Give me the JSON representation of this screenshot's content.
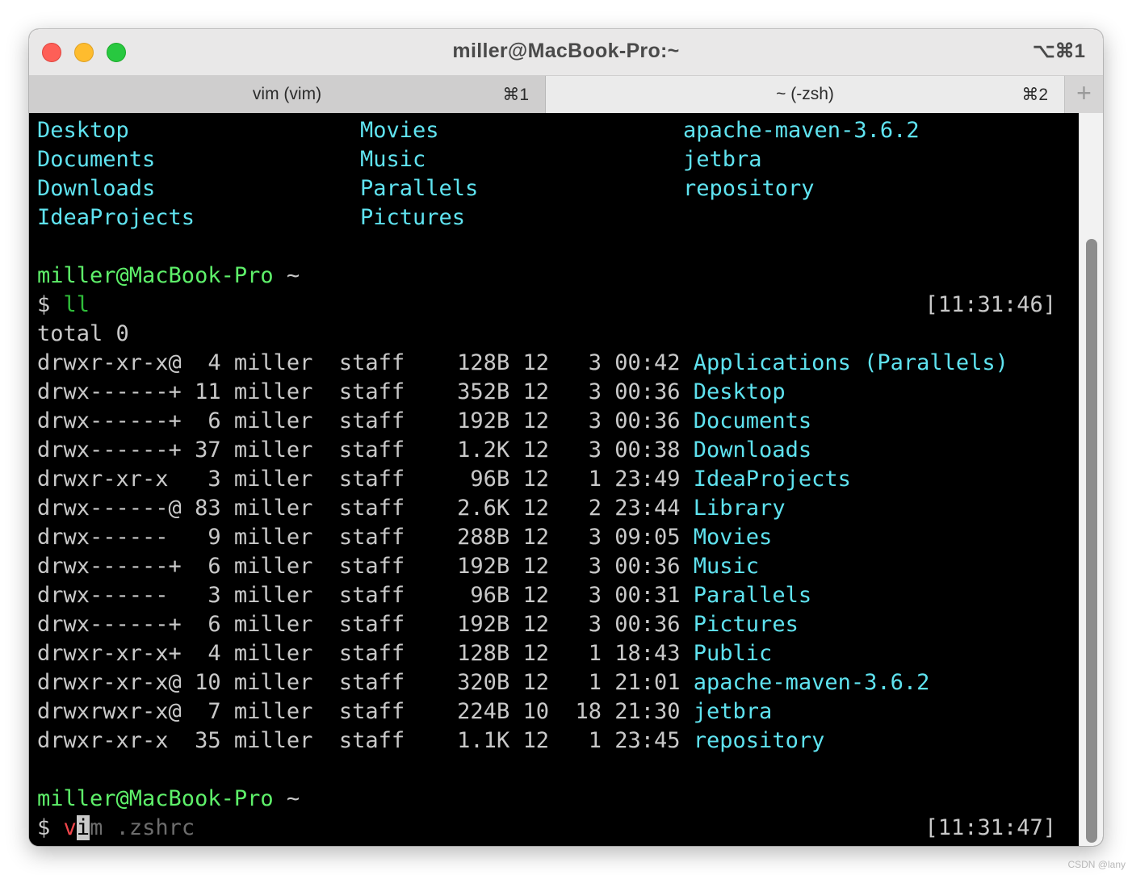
{
  "window": {
    "title": "miller@MacBook-Pro:~",
    "shortcut": "⌥⌘1"
  },
  "tabs": [
    {
      "label": "vim (vim)",
      "key": "⌘1"
    },
    {
      "label": "~ (-zsh)",
      "key": "⌘2"
    }
  ],
  "add_tab": "+",
  "listing_columns": [
    [
      "Desktop",
      "Documents",
      "Downloads",
      "IdeaProjects"
    ],
    [
      "Movies",
      "Music",
      "Parallels",
      "Pictures"
    ],
    [
      "apache-maven-3.6.2",
      "jetbra",
      "repository"
    ]
  ],
  "prompt1": {
    "user_host": "miller@MacBook-Pro",
    "dir": "~",
    "symbol": "$",
    "command": "ll",
    "timestamp": "[11:31:46]"
  },
  "total_line": "total 0",
  "entries": [
    {
      "perm": "drwxr-xr-x@",
      "links": "4",
      "owner": "miller",
      "group": "staff",
      "size": "128B",
      "month": "12",
      "day": "3",
      "time": "00:42",
      "name": "Applications (Parallels)"
    },
    {
      "perm": "drwx------+",
      "links": "11",
      "owner": "miller",
      "group": "staff",
      "size": "352B",
      "month": "12",
      "day": "3",
      "time": "00:36",
      "name": "Desktop"
    },
    {
      "perm": "drwx------+",
      "links": "6",
      "owner": "miller",
      "group": "staff",
      "size": "192B",
      "month": "12",
      "day": "3",
      "time": "00:36",
      "name": "Documents"
    },
    {
      "perm": "drwx------+",
      "links": "37",
      "owner": "miller",
      "group": "staff",
      "size": "1.2K",
      "month": "12",
      "day": "3",
      "time": "00:38",
      "name": "Downloads"
    },
    {
      "perm": "drwxr-xr-x",
      "links": "3",
      "owner": "miller",
      "group": "staff",
      "size": "96B",
      "month": "12",
      "day": "1",
      "time": "23:49",
      "name": "IdeaProjects"
    },
    {
      "perm": "drwx------@",
      "links": "83",
      "owner": "miller",
      "group": "staff",
      "size": "2.6K",
      "month": "12",
      "day": "2",
      "time": "23:44",
      "name": "Library"
    },
    {
      "perm": "drwx------",
      "links": "9",
      "owner": "miller",
      "group": "staff",
      "size": "288B",
      "month": "12",
      "day": "3",
      "time": "09:05",
      "name": "Movies"
    },
    {
      "perm": "drwx------+",
      "links": "6",
      "owner": "miller",
      "group": "staff",
      "size": "192B",
      "month": "12",
      "day": "3",
      "time": "00:36",
      "name": "Music"
    },
    {
      "perm": "drwx------",
      "links": "3",
      "owner": "miller",
      "group": "staff",
      "size": "96B",
      "month": "12",
      "day": "3",
      "time": "00:31",
      "name": "Parallels"
    },
    {
      "perm": "drwx------+",
      "links": "6",
      "owner": "miller",
      "group": "staff",
      "size": "192B",
      "month": "12",
      "day": "3",
      "time": "00:36",
      "name": "Pictures"
    },
    {
      "perm": "drwxr-xr-x+",
      "links": "4",
      "owner": "miller",
      "group": "staff",
      "size": "128B",
      "month": "12",
      "day": "1",
      "time": "18:43",
      "name": "Public"
    },
    {
      "perm": "drwxr-xr-x@",
      "links": "10",
      "owner": "miller",
      "group": "staff",
      "size": "320B",
      "month": "12",
      "day": "1",
      "time": "21:01",
      "name": "apache-maven-3.6.2"
    },
    {
      "perm": "drwxrwxr-x@",
      "links": "7",
      "owner": "miller",
      "group": "staff",
      "size": "224B",
      "month": "10",
      "day": "18",
      "time": "21:30",
      "name": "jetbra"
    },
    {
      "perm": "drwxr-xr-x",
      "links": "35",
      "owner": "miller",
      "group": "staff",
      "size": "1.1K",
      "month": "12",
      "day": "1",
      "time": "23:45",
      "name": "repository"
    }
  ],
  "prompt2": {
    "user_host": "miller@MacBook-Pro",
    "dir": "~",
    "symbol": "$",
    "typed_v": "v",
    "cursor_char": "i",
    "suggestion": "m .zshrc",
    "timestamp": "[11:31:47]"
  },
  "watermark": "CSDN @lany"
}
